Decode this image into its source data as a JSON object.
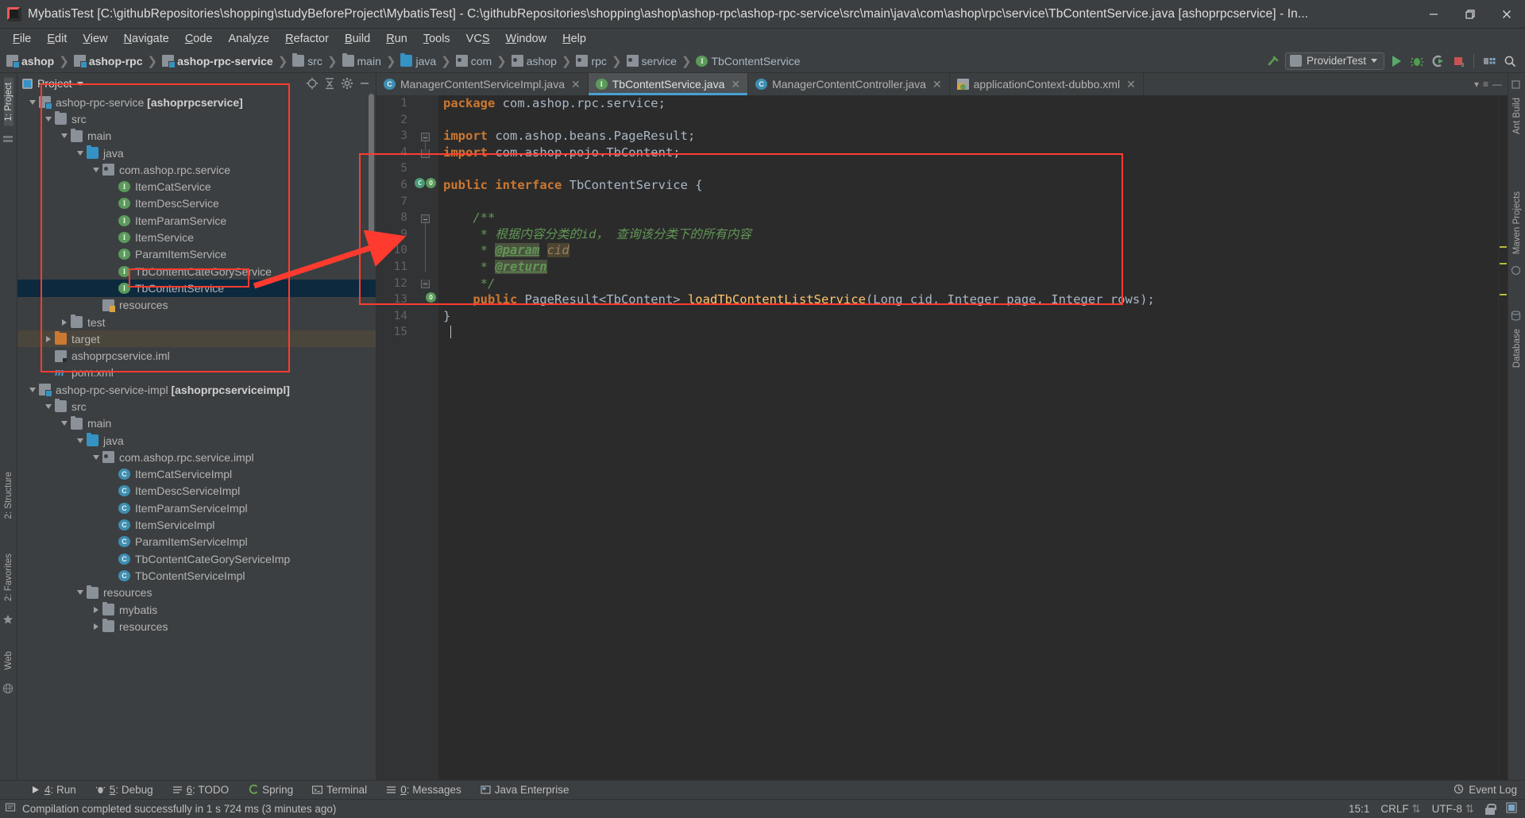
{
  "window": {
    "title": "MybatisTest [C:\\githubRepositories\\shopping\\studyBeforeProject\\MybatisTest] - C:\\githubRepositories\\shopping\\ashop\\ashop-rpc\\ashop-rpc-service\\src\\main\\java\\com\\ashop\\rpc\\service\\TbContentService.java [ashoprpcservice] - In...",
    "minimize": "—",
    "maximize": "❐",
    "close": "✕",
    "logo_icon": "intellij-logo-icon"
  },
  "menubar": {
    "items": [
      {
        "label": "File",
        "mnemonic": "F"
      },
      {
        "label": "Edit",
        "mnemonic": "E"
      },
      {
        "label": "View",
        "mnemonic": "V"
      },
      {
        "label": "Navigate",
        "mnemonic": "N"
      },
      {
        "label": "Code",
        "mnemonic": "C"
      },
      {
        "label": "Analyze",
        "mnemonic": "y"
      },
      {
        "label": "Refactor",
        "mnemonic": "R"
      },
      {
        "label": "Build",
        "mnemonic": "B"
      },
      {
        "label": "Run",
        "mnemonic": "R"
      },
      {
        "label": "Tools",
        "mnemonic": "T"
      },
      {
        "label": "VCS",
        "mnemonic": "S"
      },
      {
        "label": "Window",
        "mnemonic": "W"
      },
      {
        "label": "Help",
        "mnemonic": "H"
      }
    ]
  },
  "navbar": {
    "crumbs": [
      {
        "label": "ashop",
        "icon": "module-icon",
        "bold": true
      },
      {
        "label": "ashop-rpc",
        "icon": "module-icon",
        "bold": true
      },
      {
        "label": "ashop-rpc-service",
        "icon": "module-icon",
        "bold": true
      },
      {
        "label": "src",
        "icon": "folder-icon",
        "bold": false
      },
      {
        "label": "main",
        "icon": "folder-icon",
        "bold": false
      },
      {
        "label": "java",
        "icon": "source-folder-icon",
        "bold": false
      },
      {
        "label": "com",
        "icon": "package-icon",
        "bold": false
      },
      {
        "label": "ashop",
        "icon": "package-icon",
        "bold": false
      },
      {
        "label": "rpc",
        "icon": "package-icon",
        "bold": false
      },
      {
        "label": "service",
        "icon": "package-icon",
        "bold": false
      },
      {
        "label": "TbContentService",
        "icon": "interface-icon",
        "bold": false
      }
    ],
    "run_config": "ProviderTest",
    "toolbar_icons": [
      "build-hammer-icon",
      "run-icon",
      "debug-icon",
      "run-with-coverage-icon",
      "stop-icon",
      "project-structure-icon",
      "search-everywhere-icon"
    ]
  },
  "project_panel": {
    "title": "Project",
    "header_icons": [
      "locate-icon",
      "collapse-all-icon",
      "gear-icon",
      "hide-icon"
    ],
    "tree": [
      {
        "depth": 1,
        "label": "ashop-rpc-service ",
        "bold_suffix": "[ashoprpcservice]",
        "icon": "module-icon",
        "expander": "down"
      },
      {
        "depth": 2,
        "label": "src",
        "icon": "folder-icon",
        "expander": "down"
      },
      {
        "depth": 3,
        "label": "main",
        "icon": "folder-icon",
        "expander": "down"
      },
      {
        "depth": 4,
        "label": "java",
        "icon": "source-folder-icon",
        "expander": "down"
      },
      {
        "depth": 5,
        "label": "com.ashop.rpc.service",
        "icon": "package-icon",
        "expander": "down"
      },
      {
        "depth": 6,
        "label": "ItemCatService",
        "icon": "interface-icon",
        "expander": "none"
      },
      {
        "depth": 6,
        "label": "ItemDescService",
        "icon": "interface-icon",
        "expander": "none"
      },
      {
        "depth": 6,
        "label": "ItemParamService",
        "icon": "interface-icon",
        "expander": "none"
      },
      {
        "depth": 6,
        "label": "ItemService",
        "icon": "interface-icon",
        "expander": "none"
      },
      {
        "depth": 6,
        "label": "ParamItemService",
        "icon": "interface-icon",
        "expander": "none"
      },
      {
        "depth": 6,
        "label": "TbContentCateGoryService",
        "icon": "interface-icon",
        "expander": "none"
      },
      {
        "depth": 6,
        "label": "TbContentService",
        "icon": "interface-icon",
        "expander": "none",
        "selected": true
      },
      {
        "depth": 5,
        "label": "resources",
        "icon": "resource-folder-icon",
        "expander": "none"
      },
      {
        "depth": 3,
        "label": "test",
        "icon": "folder-icon",
        "expander": "right"
      },
      {
        "depth": 2,
        "label": "target",
        "icon": "folder-orange-icon",
        "expander": "right",
        "highlight": true
      },
      {
        "depth": 2,
        "label": "ashoprpcservice.iml",
        "icon": "iml-file-icon",
        "expander": "none"
      },
      {
        "depth": 2,
        "label": "pom.xml",
        "icon": "maven-m-icon",
        "expander": "none"
      },
      {
        "depth": 1,
        "label": "ashop-rpc-service-impl ",
        "bold_suffix": "[ashoprpcserviceimpl]",
        "icon": "module-icon",
        "expander": "down"
      },
      {
        "depth": 2,
        "label": "src",
        "icon": "folder-icon",
        "expander": "down"
      },
      {
        "depth": 3,
        "label": "main",
        "icon": "folder-icon",
        "expander": "down"
      },
      {
        "depth": 4,
        "label": "java",
        "icon": "source-folder-icon",
        "expander": "down"
      },
      {
        "depth": 5,
        "label": "com.ashop.rpc.service.impl",
        "icon": "package-icon",
        "expander": "down"
      },
      {
        "depth": 6,
        "label": "ItemCatServiceImpl",
        "icon": "class-icon",
        "expander": "none"
      },
      {
        "depth": 6,
        "label": "ItemDescServiceImpl",
        "icon": "class-icon",
        "expander": "none"
      },
      {
        "depth": 6,
        "label": "ItemParamServiceImpl",
        "icon": "class-icon",
        "expander": "none"
      },
      {
        "depth": 6,
        "label": "ItemServiceImpl",
        "icon": "class-icon",
        "expander": "none"
      },
      {
        "depth": 6,
        "label": "ParamItemServiceImpl",
        "icon": "class-icon",
        "expander": "none"
      },
      {
        "depth": 6,
        "label": "TbContentCateGoryServiceImp",
        "icon": "class-icon",
        "expander": "none"
      },
      {
        "depth": 6,
        "label": "TbContentServiceImpl",
        "icon": "class-icon",
        "expander": "none"
      },
      {
        "depth": 4,
        "label": "resources",
        "icon": "folder-icon",
        "expander": "down"
      },
      {
        "depth": 5,
        "label": "mybatis",
        "icon": "folder-icon",
        "expander": "right"
      },
      {
        "depth": 5,
        "label": "resources",
        "icon": "folder-icon",
        "expander": "right"
      }
    ]
  },
  "editor": {
    "tabs": [
      {
        "label": "ManagerContentServiceImpl.java",
        "icon": "class-icon",
        "active": false,
        "close": "✕"
      },
      {
        "label": "TbContentService.java",
        "icon": "interface-icon",
        "active": true,
        "close": "✕"
      },
      {
        "label": "ManagerContentController.java",
        "icon": "class-icon",
        "active": false,
        "close": "✕"
      },
      {
        "label": "applicationContext-dubbo.xml",
        "icon": "xml-spring-icon",
        "active": false,
        "close": "✕"
      }
    ],
    "line_numbers": [
      "1",
      "2",
      "3",
      "4",
      "5",
      "6",
      "7",
      "8",
      "9",
      "10",
      "11",
      "12",
      "13",
      "14",
      "15"
    ],
    "code_lines": [
      {
        "n": 1,
        "tokens": [
          {
            "t": "package",
            "c": "kw"
          },
          {
            "t": " com.ashop.rpc.service;",
            "c": "pl"
          }
        ]
      },
      {
        "n": 2,
        "tokens": []
      },
      {
        "n": 3,
        "tokens": [
          {
            "t": "import",
            "c": "kw"
          },
          {
            "t": " com.ashop.beans.PageResult;",
            "c": "pl"
          }
        ]
      },
      {
        "n": 4,
        "tokens": [
          {
            "t": "import",
            "c": "kw"
          },
          {
            "t": " com.ashop.pojo.TbContent;",
            "c": "pl"
          }
        ]
      },
      {
        "n": 5,
        "tokens": []
      },
      {
        "n": 6,
        "tokens": [
          {
            "t": "public interface",
            "c": "kw"
          },
          {
            "t": " TbContentService {",
            "c": "pl"
          }
        ]
      },
      {
        "n": 7,
        "tokens": []
      },
      {
        "n": 8,
        "tokens": [
          {
            "t": "    /**",
            "c": "cmt"
          }
        ]
      },
      {
        "n": 9,
        "tokens": [
          {
            "t": "     * 根据内容分类的id， 查询该分类下的所有内容",
            "c": "cmt"
          }
        ]
      },
      {
        "n": 10,
        "tokens": [
          {
            "t": "     * ",
            "c": "cmt"
          },
          {
            "t": "@param",
            "c": "doctag"
          },
          {
            "t": " ",
            "c": "cmt"
          },
          {
            "t": "cid",
            "c": "docparam"
          }
        ]
      },
      {
        "n": 11,
        "tokens": [
          {
            "t": "     * ",
            "c": "cmt"
          },
          {
            "t": "@return",
            "c": "doctag"
          }
        ]
      },
      {
        "n": 12,
        "tokens": [
          {
            "t": "     */",
            "c": "cmt"
          }
        ]
      },
      {
        "n": 13,
        "tokens": [
          {
            "t": "    public",
            "c": "kw"
          },
          {
            "t": " PageResult<TbContent> ",
            "c": "pl"
          },
          {
            "t": "loadTbContentListService",
            "c": "mth"
          },
          {
            "t": "(Long cid, Integer page, Integer rows);",
            "c": "pl"
          }
        ]
      },
      {
        "n": 14,
        "tokens": [
          {
            "t": "}",
            "c": "pl"
          }
        ]
      },
      {
        "n": 15,
        "tokens": []
      }
    ]
  },
  "stripes": {
    "left_top": "1: Project",
    "left_items": [
      "2: Structure",
      "2: Favorites",
      "Web"
    ],
    "right_items": [
      "Ant Build",
      "Maven Projects",
      "Database"
    ]
  },
  "bottom_tools": [
    {
      "label": "4: Run",
      "mnemonic": "4",
      "icon": "run-icon"
    },
    {
      "label": "5: Debug",
      "mnemonic": "5",
      "icon": "debug-icon"
    },
    {
      "label": "6: TODO",
      "mnemonic": "6",
      "icon": "todo-icon"
    },
    {
      "label": "Spring",
      "mnemonic": "",
      "icon": "spring-icon"
    },
    {
      "label": "Terminal",
      "mnemonic": "",
      "icon": "terminal-icon"
    },
    {
      "label": "0: Messages",
      "mnemonic": "0",
      "icon": "messages-icon"
    },
    {
      "label": "Java Enterprise",
      "mnemonic": "",
      "icon": "java-ee-icon"
    }
  ],
  "event_log": {
    "label": "Event Log",
    "icon": "event-log-icon"
  },
  "statusbar": {
    "message": "Compilation completed successfully in 1 s 724 ms (3 minutes ago)",
    "caret_position": "15:1",
    "line_separator": "CRLF",
    "encoding": "UTF-8",
    "lock_icon": "lock-icon",
    "inspection_icon": "inspection-icon",
    "status_icon": "status-icon"
  },
  "annotations": {
    "color": "#ff3b30",
    "boxes": [
      "project-tree-box",
      "tbcontentservice-node-box",
      "interface-body-box"
    ],
    "arrow": "red-arrow-pointing-to-return-tag"
  }
}
